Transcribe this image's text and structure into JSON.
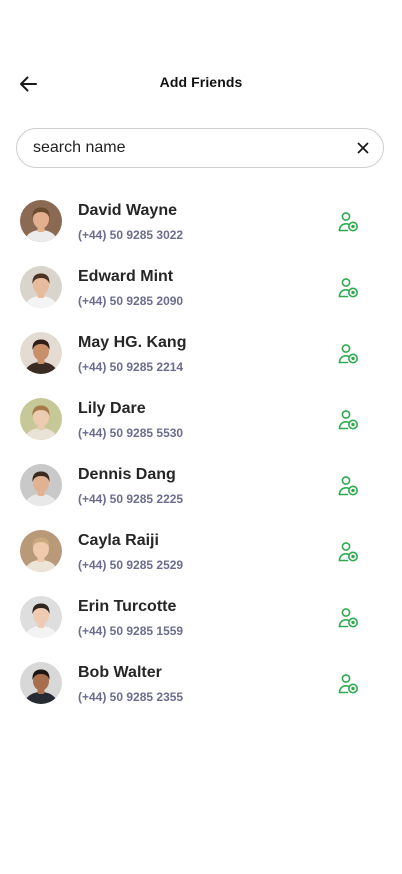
{
  "header": {
    "title": "Add Friends",
    "back_icon": "arrow-left-icon"
  },
  "search": {
    "value": "search name",
    "placeholder": "search name",
    "clear_icon": "close-icon"
  },
  "colors": {
    "accent_green": "#2eaa4f",
    "phone_text": "#6b6d8f"
  },
  "friends": [
    {
      "name": "David Wayne",
      "phone": "(+44) 50 9285 3022",
      "avatar_bg": "#8a6a52",
      "skin": "#e2b08e",
      "hair": "#6b4a2e",
      "shirt": "#ececec"
    },
    {
      "name": "Edward Mint",
      "phone": "(+44) 50 9285 2090",
      "avatar_bg": "#d9d4cc",
      "skin": "#e6bc9c",
      "hair": "#4a3324",
      "shirt": "#f4f4f4"
    },
    {
      "name": "May HG. Kang",
      "phone": "(+44) 50 9285 2214",
      "avatar_bg": "#e4dcd2",
      "skin": "#c98f6a",
      "hair": "#2f1f17",
      "shirt": "#3a2c24"
    },
    {
      "name": "Lily Dare",
      "phone": "(+44) 50 9285 5530",
      "avatar_bg": "#c6c898",
      "skin": "#edcbb0",
      "hair": "#a57a4a",
      "shirt": "#e9e2d6"
    },
    {
      "name": "Dennis Dang",
      "phone": "(+44) 50 9285 2225",
      "avatar_bg": "#c9c9c9",
      "skin": "#e0b292",
      "hair": "#3b2a20",
      "shirt": "#e8e8e8"
    },
    {
      "name": "Cayla Raiji",
      "phone": "(+44) 50 9285 2529",
      "avatar_bg": "#b89a78",
      "skin": "#efc9ab",
      "hair": "#c9a97e",
      "shirt": "#ede4d8"
    },
    {
      "name": "Erin Turcotte",
      "phone": "(+44) 50 9285 1559",
      "avatar_bg": "#dedede",
      "skin": "#eecbb2",
      "hair": "#2e2420",
      "shirt": "#f3f3f3"
    },
    {
      "name": "Bob Walter",
      "phone": "(+44) 50 9285 2355",
      "avatar_bg": "#d8d8d8",
      "skin": "#a76f4e",
      "hair": "#1e1612",
      "shirt": "#262a33"
    }
  ],
  "row_action_icon": "add-user-icon"
}
